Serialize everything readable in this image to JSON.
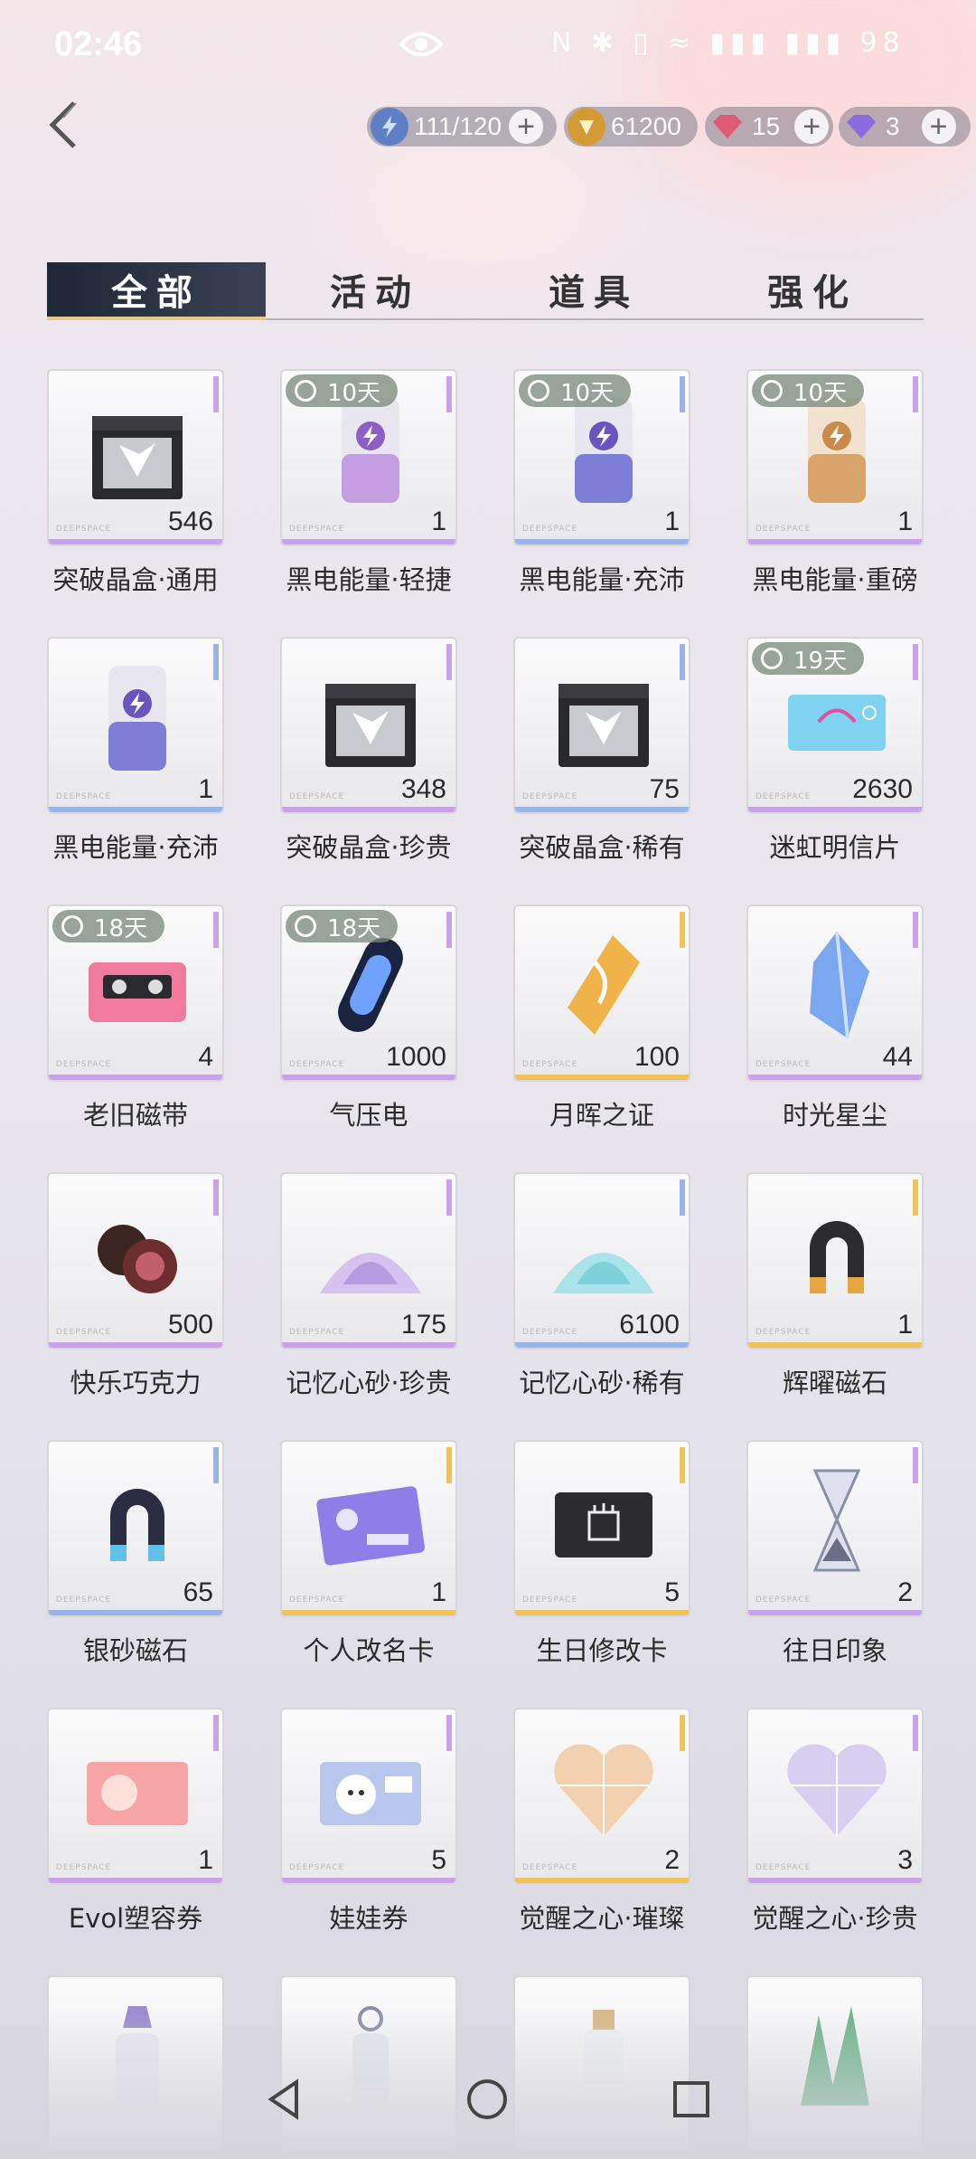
{
  "status": {
    "time": "02:46",
    "icons": "N ✱ ▯ ≈ ▮▮▮ ▮▮▮ 98"
  },
  "resources": [
    {
      "value": "111/120",
      "icon": "lightning-icon",
      "color": "#7aa7f0"
    },
    {
      "value": "61200",
      "icon": "gold-coin-icon",
      "color": "#e0b04a"
    },
    {
      "value": "15",
      "icon": "red-gem-icon",
      "color": "#e05a76"
    },
    {
      "value": "3",
      "icon": "purple-gem-icon",
      "color": "#8a6be0"
    }
  ],
  "tabs": [
    "全部",
    "活动",
    "道具",
    "强化"
  ],
  "items": [
    {
      "name": "突破晶盒·通用",
      "qty": "546",
      "timer": "",
      "rarity": "#c9a3e8",
      "art": "box-dark"
    },
    {
      "name": "黑电能量·轻捷",
      "qty": "1",
      "timer": "10天",
      "rarity": "#c9a3e8",
      "art": "can-pink"
    },
    {
      "name": "黑电能量·充沛",
      "qty": "1",
      "timer": "10天",
      "rarity": "#9bb4e8",
      "art": "can-blue"
    },
    {
      "name": "黑电能量·重磅",
      "qty": "1",
      "timer": "10天",
      "rarity": "#c9a3e8",
      "art": "can-gold"
    },
    {
      "name": "黑电能量·充沛",
      "qty": "1",
      "timer": "",
      "rarity": "#9bb4e8",
      "art": "can-blue"
    },
    {
      "name": "突破晶盒·珍贵",
      "qty": "348",
      "timer": "",
      "rarity": "#c9a3e8",
      "art": "box-dark"
    },
    {
      "name": "突破晶盒·稀有",
      "qty": "75",
      "timer": "",
      "rarity": "#9bb4e8",
      "art": "box-dark"
    },
    {
      "name": "迷虹明信片",
      "qty": "2630",
      "timer": "19天",
      "rarity": "#c9a3e8",
      "art": "card-blue"
    },
    {
      "name": "老旧磁带",
      "qty": "4",
      "timer": "18天",
      "rarity": "#c9a3e8",
      "art": "tape"
    },
    {
      "name": "气压电",
      "qty": "1000",
      "timer": "18天",
      "rarity": "#c9a3e8",
      "art": "capsule"
    },
    {
      "name": "月晖之证",
      "qty": "100",
      "timer": "",
      "rarity": "#f0c25a",
      "art": "gold-crystal"
    },
    {
      "name": "时光星尘",
      "qty": "44",
      "timer": "",
      "rarity": "#c9a3e8",
      "art": "blue-crystal"
    },
    {
      "name": "快乐巧克力",
      "qty": "500",
      "timer": "",
      "rarity": "#c9a3e8",
      "art": "chocolate"
    },
    {
      "name": "记忆心砂·珍贵",
      "qty": "175",
      "timer": "",
      "rarity": "#c9a3e8",
      "art": "sand-purple"
    },
    {
      "name": "记忆心砂·稀有",
      "qty": "6100",
      "timer": "",
      "rarity": "#9bb4e8",
      "art": "sand-cyan"
    },
    {
      "name": "辉曜磁石",
      "qty": "1",
      "timer": "",
      "rarity": "#f0c25a",
      "art": "magnet-gold"
    },
    {
      "name": "银砂磁石",
      "qty": "65",
      "timer": "",
      "rarity": "#9bb4e8",
      "art": "magnet-blue"
    },
    {
      "name": "个人改名卡",
      "qty": "1",
      "timer": "",
      "rarity": "#f0c25a",
      "art": "rename-card"
    },
    {
      "name": "生日修改卡",
      "qty": "5",
      "timer": "",
      "rarity": "#f0c25a",
      "art": "birthday-card"
    },
    {
      "name": "往日印象",
      "qty": "2",
      "timer": "",
      "rarity": "#c9a3e8",
      "art": "hourglass"
    },
    {
      "name": "Evol塑容券",
      "qty": "1",
      "timer": "",
      "rarity": "#c9a3e8",
      "art": "evol-ticket"
    },
    {
      "name": "娃娃券",
      "qty": "5",
      "timer": "",
      "rarity": "#c9a3e8",
      "art": "doll-ticket"
    },
    {
      "name": "觉醒之心·璀璨",
      "qty": "2",
      "timer": "",
      "rarity": "#f0c25a",
      "art": "heart-gold"
    },
    {
      "name": "觉醒之心·珍贵",
      "qty": "3",
      "timer": "",
      "rarity": "#c9a3e8",
      "art": "heart-purple"
    }
  ],
  "partial_row_art": [
    "perfume",
    "bottle",
    "jar",
    "green-crystal"
  ],
  "watermark": "DEEPSPACE"
}
